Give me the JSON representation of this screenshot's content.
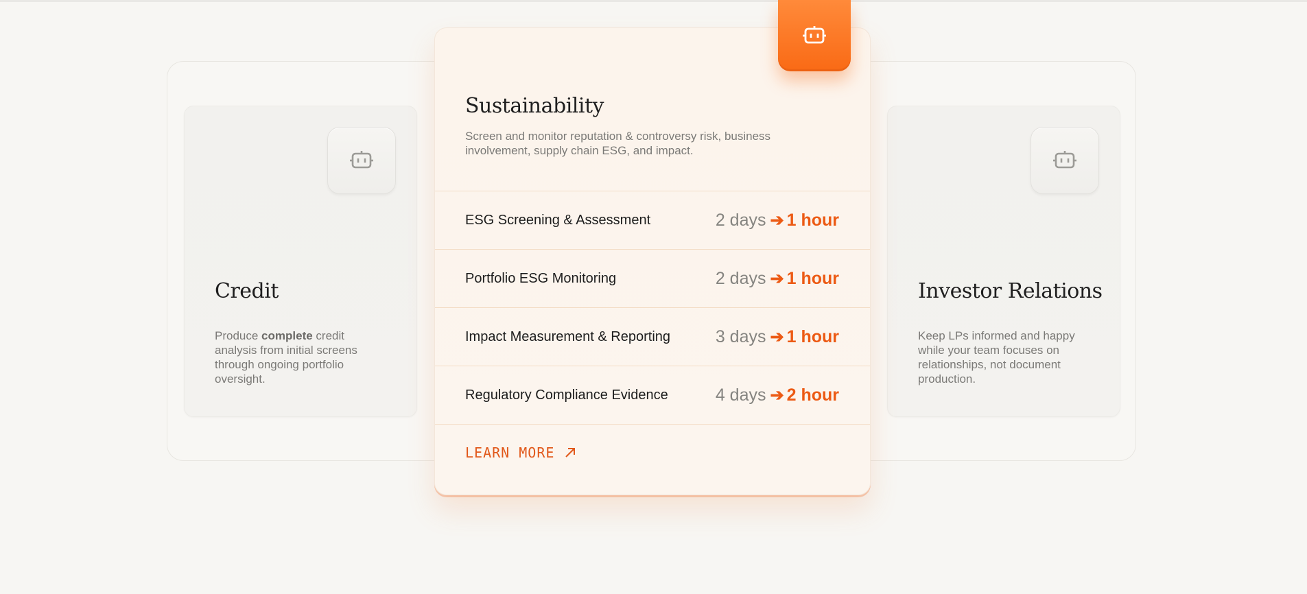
{
  "cards": {
    "left": {
      "title": "Credit",
      "desc_before": "Produce ",
      "desc_bold": "complete",
      "desc_after": " credit analysis from initial screens through ongoing portfolio oversight.",
      "icon": "robot-icon"
    },
    "center": {
      "title": "Sustainability",
      "desc": "Screen and monitor reputation & controversy risk, business involvement, supply chain ESG, and impact.",
      "icon": "robot-icon",
      "rows": [
        {
          "label": "ESG Screening & Assessment",
          "from": "2 days",
          "to": "1 hour"
        },
        {
          "label": "Portfolio ESG Monitoring",
          "from": "2 days",
          "to": "1 hour"
        },
        {
          "label": "Impact Measurement & Reporting",
          "from": "3 days",
          "to": "1 hour"
        },
        {
          "label": "Regulatory Compliance Evidence",
          "from": "4 days",
          "to": "2 hour"
        }
      ],
      "learn_more": "LEARN MORE",
      "learn_more_icon": "arrow-up-right-icon"
    },
    "right": {
      "title": "Investor Relations",
      "desc": "Keep LPs informed and happy while your team focuses on relationships, not document production.",
      "icon": "robot-icon"
    }
  },
  "colors": {
    "accent": "#ec5a14",
    "badge": "#f96a15",
    "text_muted": "#7b7a77"
  }
}
